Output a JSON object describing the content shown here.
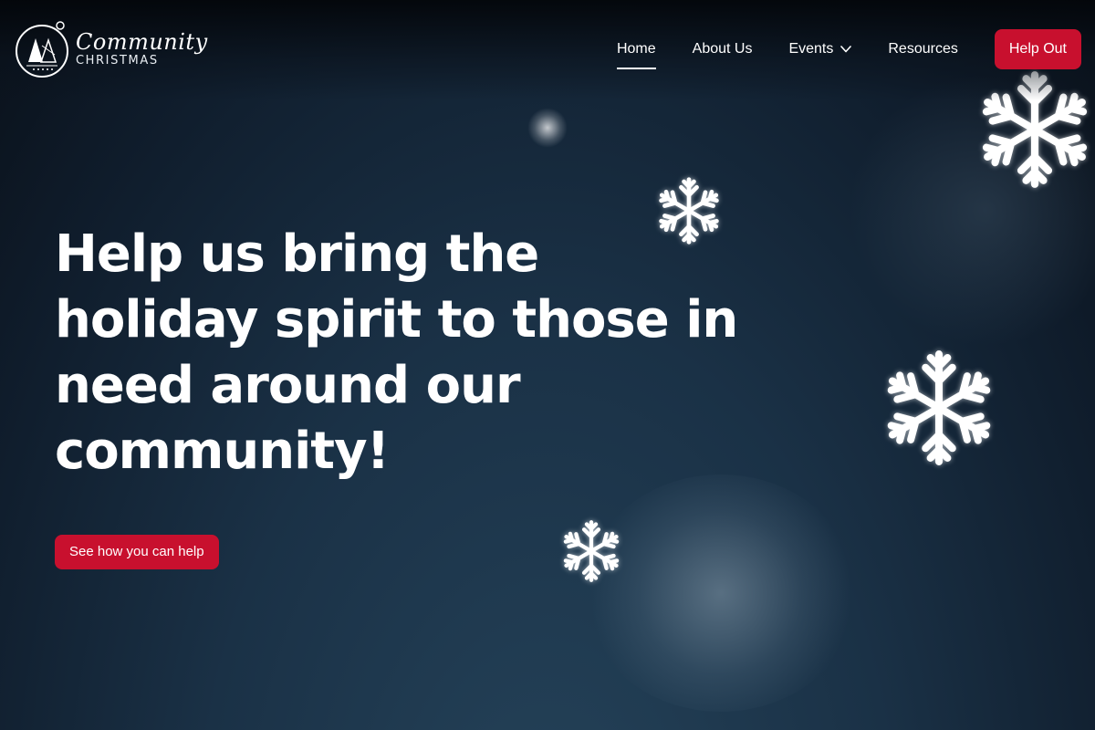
{
  "brand": {
    "name_script": "Community",
    "name_caps": "CHRISTMAS"
  },
  "nav": {
    "items": [
      {
        "label": "Home",
        "active": true
      },
      {
        "label": "About Us",
        "active": false
      },
      {
        "label": "Events",
        "active": false,
        "has_dropdown": true,
        "icon": "chevron-down-icon"
      },
      {
        "label": "Resources",
        "active": false
      }
    ],
    "cta_label": "Help Out"
  },
  "hero": {
    "lines": [
      "Help us bring the",
      "holiday spirit to those in",
      "need around our",
      "community!"
    ],
    "cta_label": "See how you can help"
  },
  "decor": {
    "icons": [
      "logo-tree-icon",
      "snowflake-icon",
      "chevron-down-icon"
    ]
  },
  "colors": {
    "accent": "#c8102e",
    "background": "#1a3146",
    "text": "#ffffff"
  }
}
